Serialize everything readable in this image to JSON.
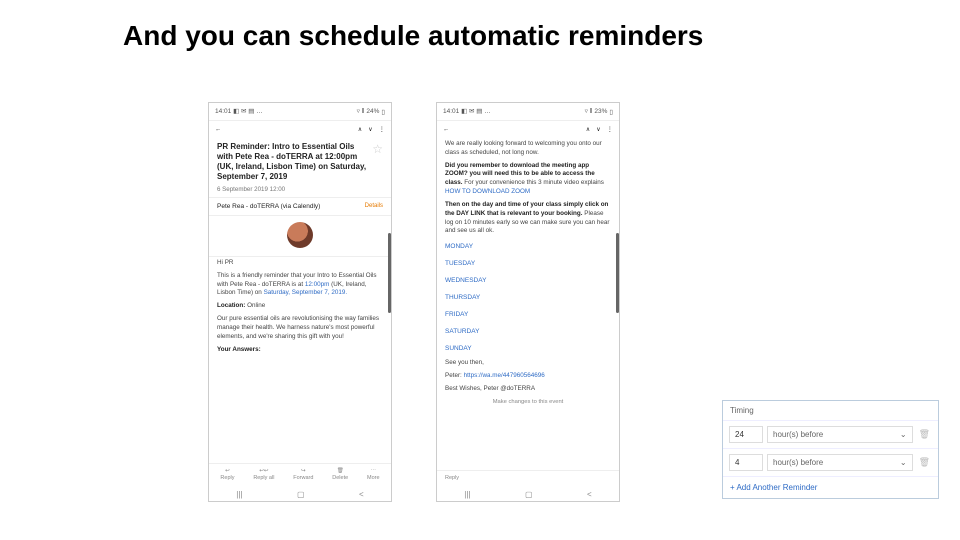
{
  "slide": {
    "title": "And you can schedule automatic reminders"
  },
  "status": {
    "time": "14:01",
    "icons": "◧ ✉ ▤ …",
    "battery1": "24%",
    "battery2": "23%",
    "signal": "▿ ⫴"
  },
  "nav": {
    "back": "←",
    "up": "∧",
    "down": "∨",
    "more": "⋮"
  },
  "email1": {
    "subject": "PR Reminder: Intro to Essential Oils with Pete Rea - doTERRA at 12:00pm (UK, Ireland, Lisbon Time) on Saturday, September 7, 2019",
    "date": "6 September 2019 12:00",
    "sender": "Pete Rea - doTERRA (via Calendly)",
    "details": "Details",
    "hi": "Hi PR",
    "p1_pre": "This is a friendly reminder that your Intro to Essential Oils with Pete Rea - doTERRA is at ",
    "p1_time": "12:00pm",
    "p1_mid": " (UK, Ireland, Lisbon Time) on ",
    "p1_day": "Saturday, September 7, 2019.",
    "loc_label": "Location:",
    "loc_val": "Online",
    "p2": "Our pure essential oils are revolutionising the way families manage their health. We harness nature's most powerful elements, and we're sharing this gift with you!",
    "answers": "Your Answers:",
    "actions": {
      "reply": "Reply",
      "replyall": "Reply all",
      "forward": "Forward",
      "delete": "Delete",
      "more": "More"
    }
  },
  "email2": {
    "p1": "We are really looking forward to welcoming you onto our class as scheduled, not long now.",
    "p2_pre": "Did you remember to download the meeting app ZOOM? you will need this to be able to access the class. ",
    "p2_post": "For your convenience this 3 minute video explains ",
    "p2_link": "HOW TO DOWNLOAD ZOOM",
    "p3_pre": "Then on the day and time of your class simply click on the DAY LINK that is relevant to your booking. ",
    "p3_post": "Please log on 10 minutes early so we can make sure you can hear and see us all ok.",
    "days": {
      "mon": "MONDAY",
      "tue": "TUESDAY",
      "wed": "WEDNESDAY",
      "thu": "THURSDAY",
      "fri": "FRIDAY",
      "sat": "SATURDAY",
      "sun": "SUNDAY"
    },
    "see": "See you then,",
    "sig_name": "Peter: ",
    "sig_link": "https://wa.me/447960564696",
    "best": "Best Wishes, Peter @doTERRA",
    "footer": "Make changes to this event",
    "reply": "Reply"
  },
  "softkeys": {
    "recents": "|||",
    "home": "▢",
    "back": "<"
  },
  "timing": {
    "header": "Timing",
    "row1": {
      "num": "24",
      "unit": "hour(s) before"
    },
    "row2": {
      "num": "4",
      "unit": "hour(s) before"
    },
    "add": "+ Add Another Reminder",
    "chevron": "⌄",
    "trash": "🗑"
  }
}
